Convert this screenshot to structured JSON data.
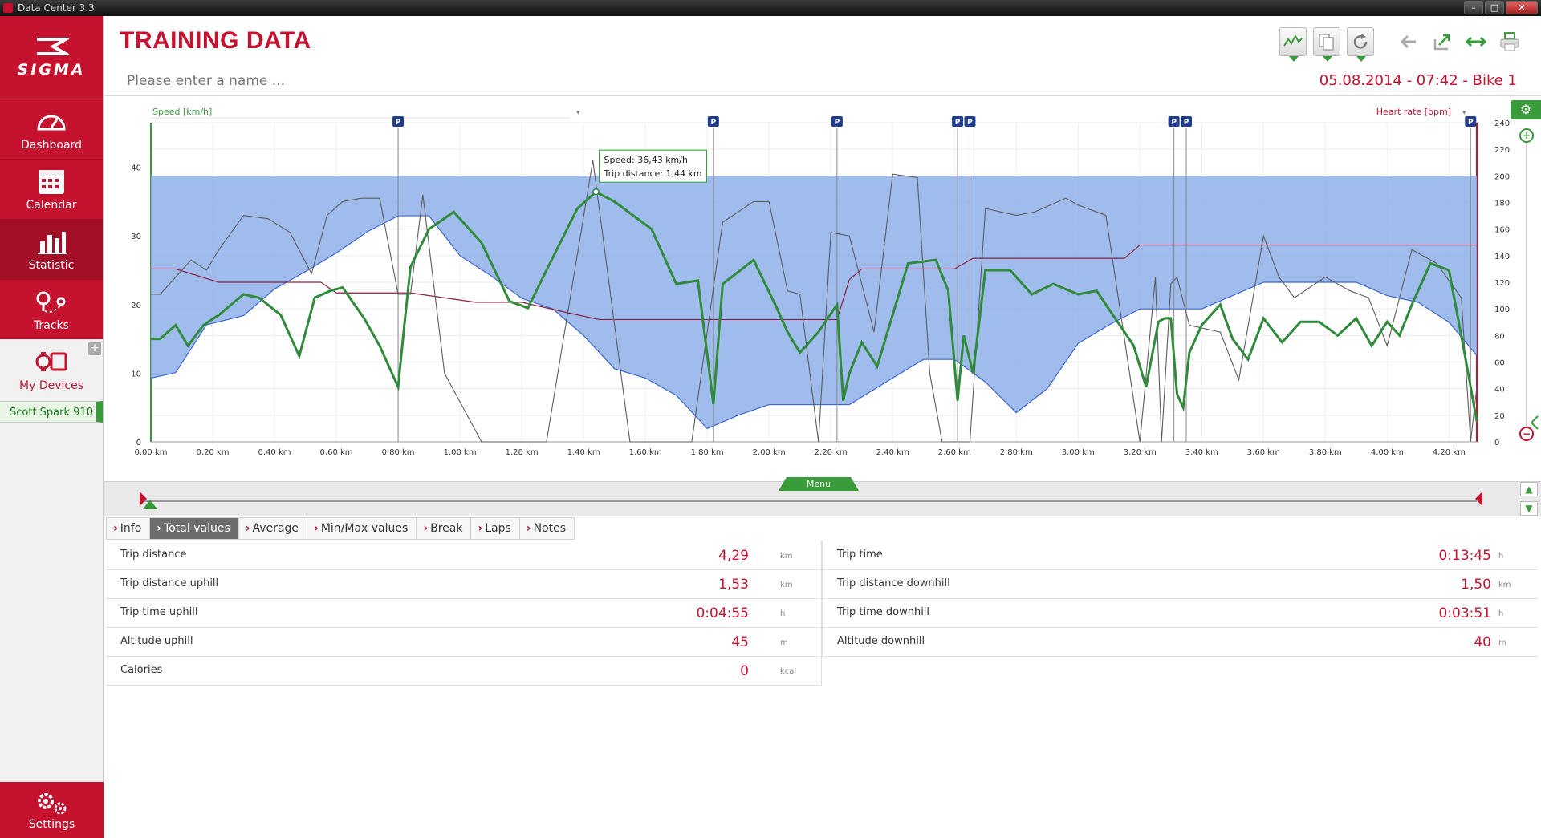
{
  "window": {
    "title": "Data Center 3.3",
    "controls": [
      "–",
      "□",
      "✕"
    ]
  },
  "sidebar": {
    "brand": "SIGMA",
    "items": [
      {
        "label": "Dashboard",
        "icon": "gauge-icon"
      },
      {
        "label": "Calendar",
        "icon": "calendar-icon"
      },
      {
        "label": "Statistic",
        "icon": "bar-chart-icon",
        "active": true
      },
      {
        "label": "Tracks",
        "icon": "map-pin-icon"
      }
    ],
    "devices_label": "My Devices",
    "device_name": "Scott Spark 910",
    "settings_label": "Settings",
    "plus": "+"
  },
  "header": {
    "title": "TRAINING DATA",
    "name_placeholder": "Please enter a name ...",
    "date": "05.08.2014 - 07:42 - Bike 1"
  },
  "chart_data": {
    "type": "line",
    "left_axis_label": "Speed [km/h]",
    "right_axis_label": "Heart rate [bpm]",
    "left_ticks": [
      "0",
      "10",
      "20",
      "30",
      "40"
    ],
    "right_ticks": [
      "0",
      "20",
      "40",
      "60",
      "80",
      "100",
      "120",
      "140",
      "160",
      "180",
      "200",
      "220",
      "240"
    ],
    "x_ticks": [
      "0,00 km",
      "0,20 km",
      "0,40 km",
      "0,60 km",
      "0,80 km",
      "1,00 km",
      "1,20 km",
      "1,40 km",
      "1,60 km",
      "1,80 km",
      "2,00 km",
      "2,20 km",
      "2,40 km",
      "2,60 km",
      "2,80 km",
      "3,00 km",
      "3,20 km",
      "3,40 km",
      "3,60 km",
      "3,80 km",
      "4,00 km",
      "4,20 km"
    ],
    "xlim": [
      0,
      4.29
    ],
    "ylim_speed": [
      0,
      46.5
    ],
    "ylim_hr": [
      0,
      240
    ],
    "pause_marker": "P",
    "pause_km": [
      0.8,
      1.82,
      2.22,
      2.61,
      2.65,
      3.31,
      3.35,
      4.27
    ],
    "tooltip": {
      "speed": "Speed: 36,43 km/h",
      "distance": "Trip distance: 1,44 km",
      "x": 1.44,
      "y": 36.43
    },
    "series": [
      {
        "color": "#2f8a3a",
        "x": [
          0,
          0.03,
          0.08,
          0.12,
          0.17,
          0.22,
          0.3,
          0.35,
          0.42,
          0.48,
          0.53,
          0.58,
          0.62,
          0.69,
          0.74,
          0.8,
          0.82,
          0.84,
          0.9,
          0.98,
          1.07,
          1.16,
          1.22,
          1.28,
          1.38,
          1.44,
          1.5,
          1.62,
          1.7,
          1.77,
          1.82,
          1.85,
          1.95,
          2.02,
          2.06,
          2.1,
          2.16,
          2.22,
          2.24,
          2.26,
          2.3,
          2.35,
          2.45,
          2.54,
          2.58,
          2.61,
          2.63,
          2.66,
          2.7,
          2.78,
          2.85,
          2.92,
          3.0,
          3.06,
          3.12,
          3.18,
          3.22,
          3.26,
          3.28,
          3.3,
          3.32,
          3.34,
          3.36,
          3.4,
          3.46,
          3.5,
          3.55,
          3.6,
          3.66,
          3.72,
          3.78,
          3.84,
          3.9,
          3.95,
          4.0,
          4.04,
          4.08,
          4.14,
          4.2,
          4.25,
          4.29
        ],
        "values": [
          15,
          15,
          17,
          14,
          17,
          18.5,
          21.5,
          21,
          18.5,
          12.5,
          21,
          22,
          22.5,
          18,
          14,
          8,
          17,
          25.5,
          31,
          33.5,
          29,
          20.5,
          19.5,
          25,
          34,
          36.4,
          35,
          31,
          23,
          23.5,
          5.5,
          23,
          26.5,
          20,
          16,
          13,
          16,
          20,
          6,
          10,
          14.5,
          11,
          26,
          26.5,
          22,
          6,
          15.5,
          10,
          25,
          25,
          21.5,
          23,
          21.5,
          22,
          18,
          14,
          8,
          17.5,
          18,
          18,
          7,
          5,
          13,
          17,
          20,
          15,
          12,
          18,
          14.5,
          17.5,
          17.5,
          15.5,
          18,
          14,
          17.5,
          15.5,
          20,
          26,
          25,
          13,
          3
        ]
      },
      {
        "color": "#5c5c5c",
        "x": [
          0,
          0.03,
          0.08,
          0.13,
          0.18,
          0.22,
          0.3,
          0.38,
          0.45,
          0.52,
          0.57,
          0.62,
          0.68,
          0.74,
          0.8,
          0.84,
          0.88,
          0.95,
          1.07,
          1.28,
          1.43,
          1.55,
          1.75,
          1.85,
          1.95,
          2.0,
          2.06,
          2.1,
          2.16,
          2.2,
          2.26,
          2.34,
          2.4,
          2.48,
          2.52,
          2.56,
          2.61,
          2.63,
          2.65,
          2.7,
          2.8,
          2.86,
          2.96,
          3.0,
          3.09,
          3.2,
          3.25,
          3.27,
          3.3,
          3.32,
          3.36,
          3.46,
          3.52,
          3.6,
          3.65,
          3.7,
          3.8,
          3.88,
          3.94,
          4.0,
          4.08,
          4.16,
          4.24,
          4.27,
          4.29
        ],
        "values": [
          21.5,
          21.5,
          24,
          26.5,
          25,
          28,
          33,
          32.5,
          30.5,
          24.5,
          33,
          35,
          35.5,
          35.5,
          21.5,
          21.5,
          36,
          10,
          -3,
          -3,
          41,
          -3,
          -3,
          32,
          35,
          35,
          22,
          21.5,
          -3,
          30.5,
          30,
          16,
          39,
          38.5,
          10,
          -3,
          -3,
          0,
          -3,
          34,
          33,
          33.5,
          35.5,
          34.5,
          33,
          0,
          24,
          -3,
          23,
          24,
          17,
          16,
          9,
          30,
          24,
          21,
          24,
          22,
          21,
          14,
          28,
          26,
          21,
          0,
          8
        ]
      },
      {
        "color": "#8a1f3f",
        "x": [
          0,
          0.08,
          0.22,
          0.4,
          0.55,
          0.6,
          0.77,
          0.84,
          1.05,
          1.2,
          1.35,
          1.45,
          1.6,
          1.8,
          2.0,
          2.22,
          2.26,
          2.3,
          2.45,
          2.6,
          2.66,
          2.75,
          2.95,
          3.15,
          3.2,
          3.4,
          3.8,
          4.29
        ],
        "values": [
          130,
          130,
          120,
          120,
          120,
          112,
          112,
          112,
          105,
          105,
          97,
          92,
          92,
          92,
          92,
          92,
          122,
          130,
          130,
          130,
          138,
          138,
          138,
          138,
          148,
          148,
          148,
          148
        ]
      },
      {
        "color": "#3a66cc",
        "x": [
          0,
          0.08,
          0.18,
          0.3,
          0.4,
          0.5,
          0.6,
          0.7,
          0.8,
          0.9,
          1.0,
          1.1,
          1.2,
          1.3,
          1.4,
          1.5,
          1.6,
          1.7,
          1.8,
          1.9,
          2.0,
          2.1,
          2.22,
          2.26,
          2.4,
          2.5,
          2.6,
          2.7,
          2.8,
          2.9,
          3.0,
          3.1,
          3.2,
          3.3,
          3.4,
          3.5,
          3.6,
          3.7,
          3.8,
          3.9,
          4.0,
          4.1,
          4.2,
          4.29
        ],
        "values": [
          48,
          52,
          88,
          95,
          115,
          128,
          142,
          158,
          170,
          170,
          140,
          125,
          108,
          100,
          80,
          55,
          48,
          35,
          10,
          20,
          28,
          28,
          28,
          28,
          48,
          62,
          62,
          45,
          22,
          40,
          74,
          88,
          100,
          100,
          100,
          110,
          120,
          120,
          120,
          120,
          110,
          105,
          90,
          65
        ]
      }
    ]
  },
  "toolbar": {
    "menu_label": "Menu"
  },
  "tabs": [
    {
      "label": "Info"
    },
    {
      "label": "Total values",
      "active": true
    },
    {
      "label": "Average"
    },
    {
      "label": "Min/Max values"
    },
    {
      "label": "Break"
    },
    {
      "label": "Laps"
    },
    {
      "label": "Notes"
    }
  ],
  "values_left": [
    {
      "label": "Trip distance",
      "value": "4,29",
      "unit": "km"
    },
    {
      "label": "Trip distance uphill",
      "value": "1,53",
      "unit": "km"
    },
    {
      "label": "Trip time uphill",
      "value": "0:04:55",
      "unit": "h"
    },
    {
      "label": "Altitude uphill",
      "value": "45",
      "unit": "m"
    },
    {
      "label": "Calories",
      "value": "0",
      "unit": "kcal"
    }
  ],
  "values_right": [
    {
      "label": "Trip time",
      "value": "0:13:45",
      "unit": "h"
    },
    {
      "label": "Trip distance downhill",
      "value": "1,50",
      "unit": "km"
    },
    {
      "label": "Trip time downhill",
      "value": "0:03:51",
      "unit": "h"
    },
    {
      "label": "Altitude downhill",
      "value": "40",
      "unit": "m"
    }
  ],
  "colors": {
    "brand": "#c4122f",
    "accent": "#3a9b3a"
  }
}
